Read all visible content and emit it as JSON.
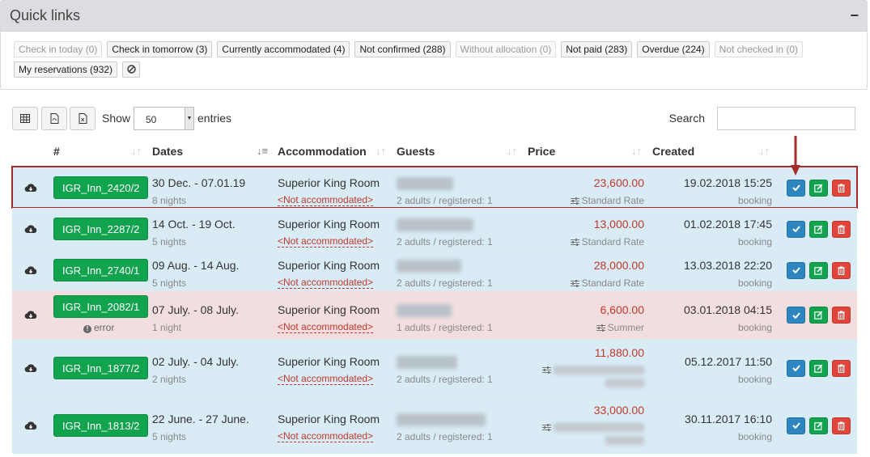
{
  "quick_links": {
    "title": "Quick links",
    "collapse_icon": "minus",
    "row1": [
      {
        "label": "Check in today (0)",
        "muted": true
      },
      {
        "label": "Check in tomorrow (3)",
        "muted": false
      },
      {
        "label": "Currently accommodated (4)",
        "muted": false
      },
      {
        "label": "Not confirmed (288)",
        "muted": false
      },
      {
        "label": "Without allocation (0)",
        "muted": true
      },
      {
        "label": "Not paid (283)",
        "muted": false
      },
      {
        "label": "Overdue (224)",
        "muted": false
      },
      {
        "label": "Not checked in (0)",
        "muted": true
      }
    ],
    "row2": [
      {
        "label": "My reservations (932)",
        "muted": false
      }
    ],
    "clear_icon": "ban-icon"
  },
  "toolbar": {
    "show_label": "Show",
    "entries_value": "50",
    "entries_label": "entries",
    "search_label": "Search",
    "search_value": ""
  },
  "table": {
    "headers": {
      "number": "#",
      "dates": "Dates",
      "accommodation": "Accommodation",
      "guests": "Guests",
      "price": "Price",
      "created": "Created"
    },
    "rows": [
      {
        "id": "IGR_Inn_2420/2",
        "dates": "30 Dec. - 07.01.19",
        "nights": "8 nights",
        "room": "Superior King Room",
        "accommodated": "<Not accommodated>",
        "guests": "2 adults / registered: 1",
        "price": "23,600.00",
        "rate": "Standard Rate",
        "created": "19.02.2018 15:25",
        "source": "booking",
        "status": "blue",
        "error": ""
      },
      {
        "id": "IGR_Inn_2287/2",
        "dates": "14 Oct. - 19 Oct.",
        "nights": "5 nights",
        "room": "Superior King Room",
        "accommodated": "<Not accommodated>",
        "guests": "2 adults / registered: 1",
        "price": "13,000.00",
        "rate": "Standard Rate",
        "created": "01.02.2018 17:45",
        "source": "booking",
        "status": "blue",
        "error": ""
      },
      {
        "id": "IGR_Inn_2740/1",
        "dates": "09 Aug. - 14 Aug.",
        "nights": "5 nights",
        "room": "Superior King Room",
        "accommodated": "<Not accommodated>",
        "guests": "2 adults / registered: 1",
        "price": "28,000.00",
        "rate": "Standard Rate",
        "created": "13.03.2018 22:20",
        "source": "booking",
        "status": "blue",
        "error": ""
      },
      {
        "id": "IGR_Inn_2082/1",
        "dates": "07 July. - 08 July.",
        "nights": "1 night",
        "room": "Superior King Room",
        "accommodated": "<Not accommodated>",
        "guests": "1 adults / registered: 1",
        "price": "6,600.00",
        "rate": "Summer",
        "created": "03.01.2018 04:15",
        "source": "booking",
        "status": "red",
        "error": "error"
      },
      {
        "id": "IGR_Inn_1877/2",
        "dates": "02 July. - 04 July.",
        "nights": "2 nights",
        "room": "Superior King Room",
        "accommodated": "<Not accommodated>",
        "guests": "2 adults / registered: 1",
        "price": "11,880.00",
        "rate": "",
        "created": "05.12.2017 11:50",
        "source": "booking",
        "status": "blue",
        "error": ""
      },
      {
        "id": "IGR_Inn_1813/2",
        "dates": "22 June. - 27 June.",
        "nights": "5 nights",
        "room": "Superior King Room",
        "accommodated": "<Not accommodated>",
        "guests": "2 adults / registered: 1",
        "price": "33,000.00",
        "rate": "",
        "created": "30.11.2017 16:10",
        "source": "booking",
        "status": "blue",
        "error": ""
      }
    ]
  },
  "colors": {
    "accent_green": "#12a34f",
    "accent_blue": "#2e86c1",
    "danger_red": "#e0443a",
    "row_blue": "#d9ebf5",
    "row_red": "#f2dede",
    "highlight": "#a52a2a"
  }
}
